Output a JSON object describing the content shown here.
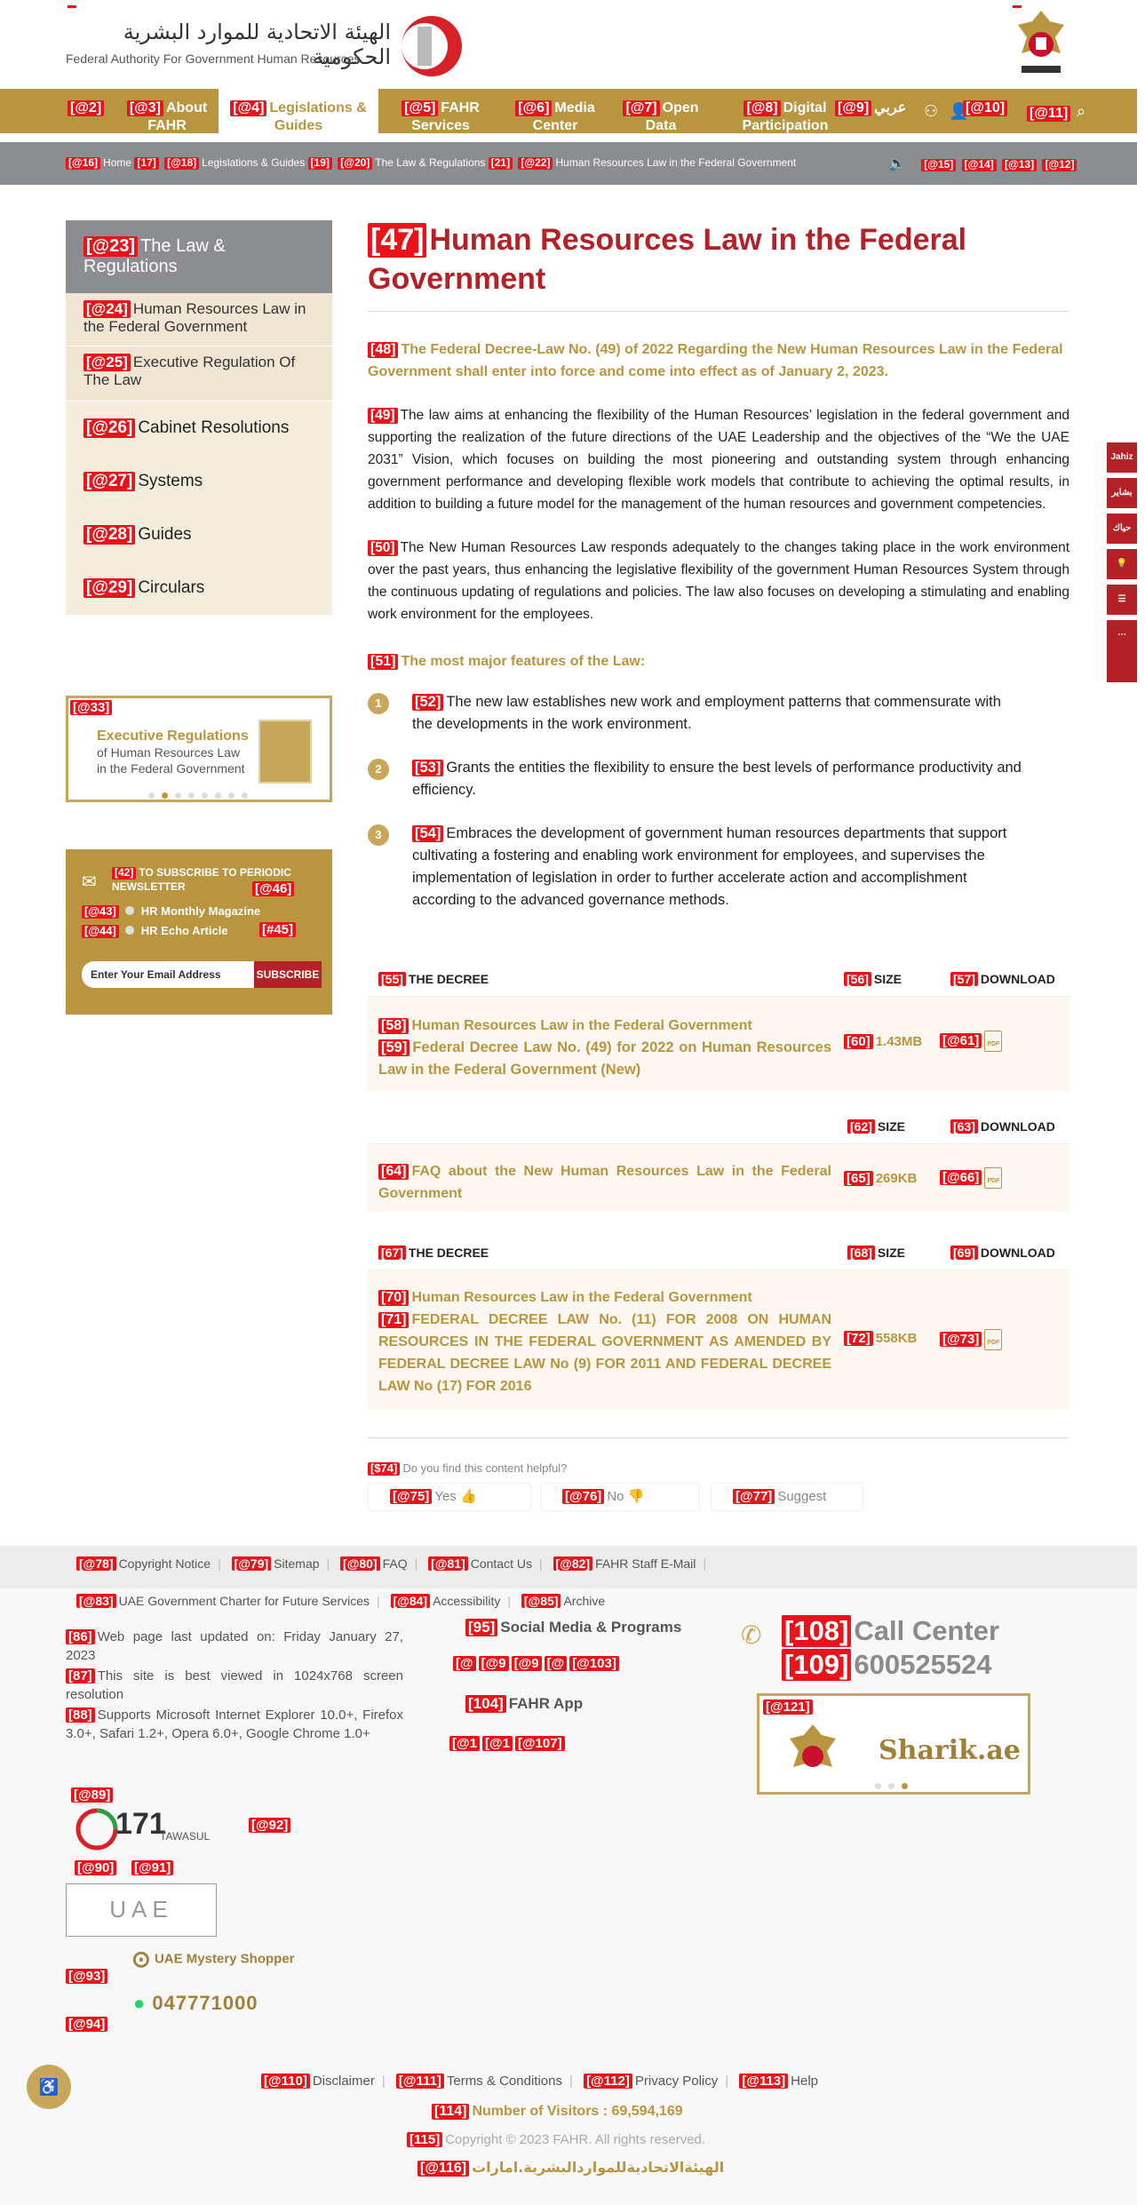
{
  "header": {
    "org_ar": "الهيئة الاتحادية للموارد البشرية الحكومية",
    "org_en": "Federal Authority For Government Human Resources"
  },
  "nav": {
    "items": [
      {
        "tag": "[@2]",
        "label": ""
      },
      {
        "tag": "[@3]",
        "label": "About FAHR"
      },
      {
        "tag": "[@4]",
        "label": "Legislations & Guides"
      },
      {
        "tag": "[@5]",
        "label": "FAHR Services"
      },
      {
        "tag": "[@6]",
        "label": "Media Center"
      },
      {
        "tag": "[@7]",
        "label": "Open Data"
      },
      {
        "tag": "[@8]",
        "label": "Digital Participation"
      },
      {
        "tag": "[@9]",
        "label": "عربي"
      },
      {
        "tag": "[@10]",
        "label": ""
      },
      {
        "tag": "[@11]",
        "label": ""
      }
    ]
  },
  "breadcrumb": {
    "items": [
      {
        "tag": "[@16]",
        "label": "Home"
      },
      {
        "tag": "[17]",
        "label": ""
      },
      {
        "tag": "[@18]",
        "label": "Legislations & Guides"
      },
      {
        "tag": "[19]",
        "label": ""
      },
      {
        "tag": "[@20]",
        "label": "The Law & Regulations"
      },
      {
        "tag": "[21]",
        "label": ""
      },
      {
        "tag": "[@22]",
        "label": "Human Resources Law in the Federal Government"
      }
    ],
    "tools": [
      "[@15]",
      "[@14]",
      "[@13]",
      "[@12]"
    ]
  },
  "sidebar": {
    "head": {
      "tag": "[@23]",
      "label": "The Law & Regulations"
    },
    "sub": [
      {
        "tag": "[@24]",
        "label": "Human Resources Law in the Federal Government"
      },
      {
        "tag": "[@25]",
        "label": "Executive Regulation Of The Law"
      }
    ],
    "main": [
      {
        "tag": "[@26]",
        "label": "Cabinet Resolutions"
      },
      {
        "tag": "[@27]",
        "label": "Systems"
      },
      {
        "tag": "[@28]",
        "label": "Guides"
      },
      {
        "tag": "[@29]",
        "label": "Circulars"
      }
    ]
  },
  "banner": {
    "tag": "[@33]",
    "line1": "Executive Regulations",
    "line2": "of Human Resources Law",
    "line3": "in the Federal Government"
  },
  "newsletter": {
    "tag": "[42]",
    "title": "TO SUBSCRIBE TO PERIODIC NEWSLETTER",
    "tag46": "[@46]",
    "opt1_tag": "[@43]",
    "opt1": "HR Monthly Magazine",
    "opt2_tag": "[@44]",
    "opt2": "HR Echo Article",
    "tag45": "[#45]",
    "placeholder": "Enter Your Email Address",
    "button": "SUBSCRIBE"
  },
  "main": {
    "title_tag": "[47]",
    "title": "Human Resources Law in the Federal Government",
    "intro_tag": "[48]",
    "intro": "The Federal Decree-Law No. (49) of 2022 Regarding the New Human Resources Law in the Federal Government shall enter into force and come into effect as of January 2, 2023.",
    "p1_tag": "[49]",
    "p1": "The law aims at enhancing the flexibility of the Human Resources’ legislation in the federal government and supporting the realization of the future directions of the UAE Leadership and the objectives of the “We the UAE 2031” Vision, which focuses on building the most pioneering and outstanding system through enhancing government performance and developing flexible work models that contribute to achieving the optimal results, in addition to building a future model for the management of the human resources and government competencies.",
    "p2_tag": "[50]",
    "p2": "The New Human Resources Law responds adequately to the changes taking place in the work environment over the past years, thus enhancing the legislative flexibility of the government Human Resources System through the continuous updating of regulations and policies. The law also focuses on developing a stimulating and enabling work environment for the employees.",
    "features_tag": "[51]",
    "features_head": "The most major features of the Law:",
    "features": [
      {
        "num": "1",
        "tag": "[52]",
        "text": "The new law establishes new work and employment patterns that commensurate with the developments in the work environment."
      },
      {
        "num": "2",
        "tag": "[53]",
        "text": "Grants the entities the flexibility to ensure the best levels of performance productivity and efficiency."
      },
      {
        "num": "3",
        "tag": "[54]",
        "text": "Embraces the development of government human resources departments that support cultivating a fostering and enabling work environment for employees, and supervises the implementation of legislation in order to further accelerate action and accomplishment according to the advanced governance methods."
      }
    ]
  },
  "tables": [
    {
      "head": {
        "decree_tag": "[55]",
        "decree": "THE DECREE",
        "size_tag": "[56]",
        "size": "SIZE",
        "dl_tag": "[57]",
        "dl": "DOWNLOAD"
      },
      "title_tag": "[58]",
      "title": "Human Resources Law in the Federal Government",
      "body_tag": "[59]",
      "body": "Federal Decree Law No. (49) for 2022 on Human Resources Law in the Federal Government (New)",
      "size_tag": "[60]",
      "size": "1.43MB",
      "dl_tag": "[@61]"
    },
    {
      "head": {
        "decree_tag": "",
        "decree": "",
        "size_tag": "[62]",
        "size": "SIZE",
        "dl_tag": "[63]",
        "dl": "DOWNLOAD"
      },
      "title_tag": "",
      "title": "",
      "body_tag": "[64]",
      "body": "FAQ about the New Human Resources Law in the Federal Government",
      "size_tag": "[65]",
      "size": "269KB",
      "dl_tag": "[@66]"
    },
    {
      "head": {
        "decree_tag": "[67]",
        "decree": "THE DECREE",
        "size_tag": "[68]",
        "size": "SIZE",
        "dl_tag": "[69]",
        "dl": "DOWNLOAD"
      },
      "title_tag": "[70]",
      "title": "Human Resources Law in the Federal Government",
      "body_tag": "[71]",
      "body": "FEDERAL DECREE LAW No. (11) FOR 2008 ON HUMAN RESOURCES IN THE FEDERAL GOVERNMENT AS AMENDED BY FEDERAL DECREE LAW No (9) FOR 2011 AND FEDERAL DECREE LAW No (17) FOR 2016",
      "size_tag": "[72]",
      "size": "558KB",
      "dl_tag": "[@73]"
    }
  ],
  "pdf_label": "PDF",
  "helpful": {
    "q_tag": "[$74]",
    "q": "Do you find this content helpful?",
    "yes_tag": "[@75]",
    "yes": "Yes",
    "no_tag": "[@76]",
    "no": "No",
    "suggest_tag": "[@77]",
    "suggest": "Suggest"
  },
  "footer": {
    "links1": [
      {
        "tag": "[@78]",
        "label": "Copyright Notice"
      },
      {
        "tag": "[@79]",
        "label": "Sitemap"
      },
      {
        "tag": "[@80]",
        "label": "FAQ"
      },
      {
        "tag": "[@81]",
        "label": "Contact Us"
      },
      {
        "tag": "[@82]",
        "label": "FAHR Staff E-Mail"
      }
    ],
    "links2": [
      {
        "tag": "[@83]",
        "label": "UAE Government Charter for Future Services"
      },
      {
        "tag": "[@84]",
        "label": "Accessibility"
      },
      {
        "tag": "[@85]",
        "label": "Archive"
      }
    ],
    "info1_tag": "[86]",
    "info1": "Web page last updated on: Friday January 27, 2023",
    "info2_tag": "[87]",
    "info2": "This site is best viewed in 1024x768 screen resolution",
    "info3_tag": "[88]",
    "info3": "Supports Microsoft Internet Explorer 10.0+, Firefox 3.0+, Safari 1.2+, Opera 6.0+, Google Chrome 1.0+",
    "social_tag": "[95]",
    "social": "Social Media & Programs",
    "social_icons_tag": "[@103]",
    "app_tag": "[104]",
    "app": "FAHR App",
    "app_icons_tag": "[@107]",
    "call_tag": "[108]",
    "call": "Call Center",
    "phone_tag": "[109]",
    "phone": "600525524",
    "sharik_tag": "[@121]",
    "sharik": "Sharik.ae",
    "tawasul_tag": "[@89]",
    "tawasul_num": "171",
    "tawasul": "TAWASUL",
    "tag90": "[@90]",
    "tag91": "[@91]",
    "tag92": "[@92]",
    "tag93": "[@93]",
    "tag94": "[@94]",
    "uae": "UAE",
    "shopper": "UAE Mystery Shopper",
    "whatsapp": "047771000",
    "bottom": [
      {
        "tag": "[@110]",
        "label": "Disclaimer"
      },
      {
        "tag": "[@111]",
        "label": "Terms & Conditions"
      },
      {
        "tag": "[@112]",
        "label": "Privacy Policy"
      },
      {
        "tag": "[@113]",
        "label": "Help"
      }
    ],
    "visitors_tag": "[114]",
    "visitors": "Number of Visitors : 69,594,169",
    "copyright_tag": "[115]",
    "copyright": "Copyright © 2023 FAHR. All rights reserved.",
    "ar_tag": "[@116]",
    "ar": "الهيئةالاتحاديةللمواردالبشرية.امارات"
  },
  "rail": [
    "Jahiz",
    "بشاير",
    "حياك",
    "",
    "",
    ""
  ]
}
